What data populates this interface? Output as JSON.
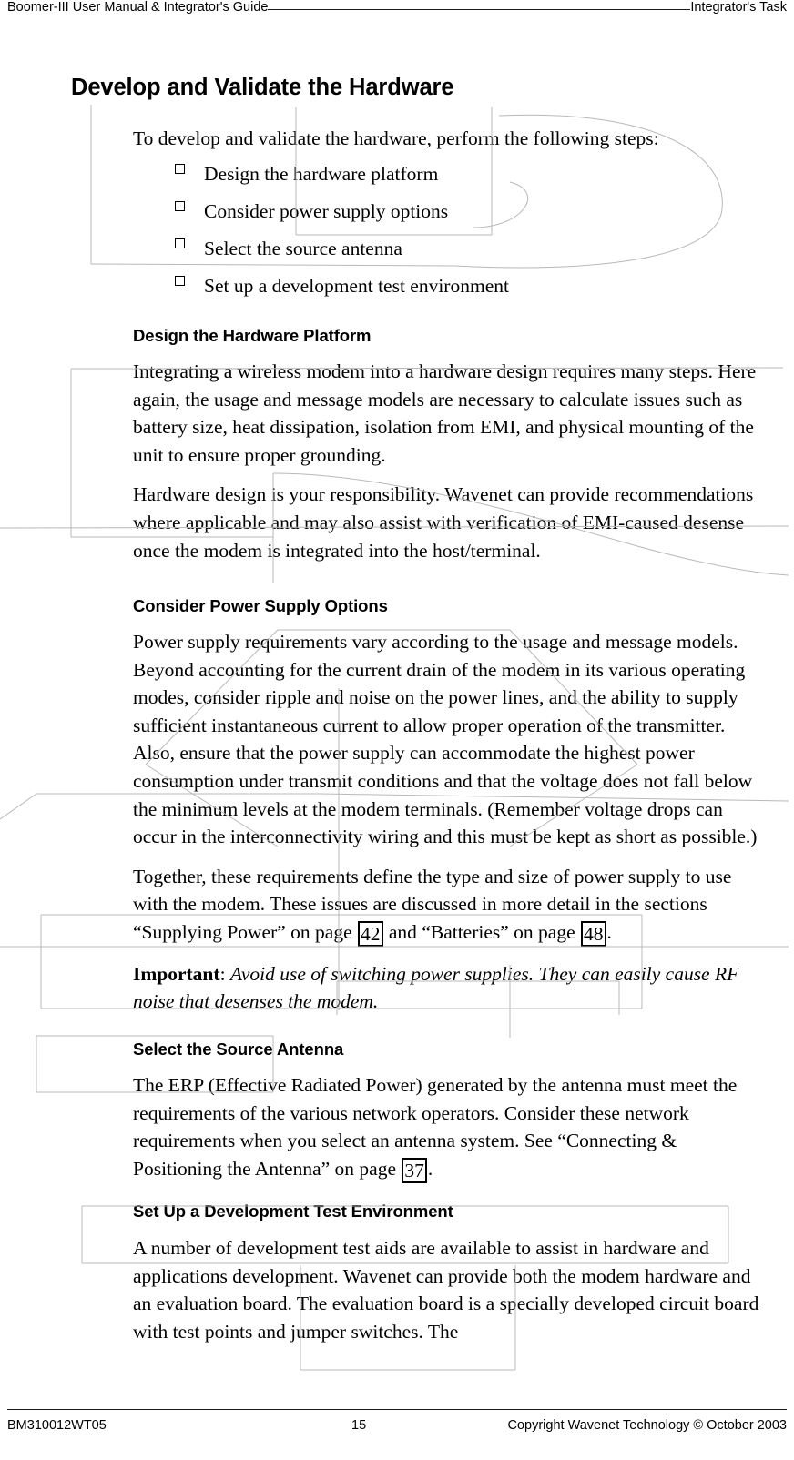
{
  "header": {
    "left_text": "Boomer-III User Manual & Integrator's Guide",
    "rule_text": "______________________________________________",
    "right_text": "Integrator's Task"
  },
  "title": "Develop and Validate the Hardware",
  "intro": "To develop and validate the hardware, perform the following steps:",
  "steps": [
    "Design the hardware platform",
    "Consider power supply options",
    "Select the source antenna",
    "Set up a development test environment"
  ],
  "sections": [
    {
      "heading": "Design the Hardware Platform",
      "paragraphs": [
        "Integrating a wireless modem into a hardware design requires many steps. Here again, the usage and message models are necessary to calculate issues such as battery size, heat dissipation, isolation from EMI, and physical mounting of the unit to ensure proper grounding.",
        "Hardware design is your responsibility. Wavenet can provide recommendations where applicable and may also assist with verification of EMI-caused desense once the modem is integrated into the host/terminal."
      ]
    },
    {
      "heading": "Consider Power Supply Options",
      "paragraphs": [
        "Power supply requirements vary according to the usage and message models. Beyond accounting for the current drain of the modem in its various operating modes, consider ripple and noise on the power lines, and the ability to supply sufficient instantaneous current to allow proper operation of the transmitter. Also, ensure that the power supply can accommodate the highest power consumption under transmit conditions and that the voltage does not fall below the minimum levels at the modem terminals. (Remember voltage drops can occur in the interconnectivity wiring and this must be kept as short as possible.)"
      ],
      "xref_paragraph": {
        "part1": "Together, these requirements define the type and size of power supply to use with the modem. These issues are discussed in more detail in the sections “Supplying Power” on page ",
        "xref1": "42",
        "part2": " and “Batteries” on page ",
        "xref2": "48",
        "part3": "."
      },
      "note": {
        "label": "Important",
        "separator": ": ",
        "text": "Avoid use of switching power supplies. They can easily cause RF noise that desenses the modem."
      }
    },
    {
      "heading": "Select the Source Antenna",
      "xref_paragraph": {
        "part1": "The ERP (Effective Radiated Power) generated by the antenna must meet the requirements of the various network operators. Consider these network requirements when you select an antenna system. See “Connecting & Positioning the Antenna” on page ",
        "xref1": "37",
        "part2": "."
      }
    },
    {
      "heading": "Set Up a Development Test Environment",
      "paragraphs": [
        "A number of development test aids are available to assist in hardware and applications development. Wavenet can provide both the modem hardware and an evaluation board. The evaluation board is a specially developed circuit board with test points and jumper switches. The"
      ]
    }
  ],
  "footer": {
    "doc_number": "BM310012WT05",
    "page_number": "15",
    "copyright": "Copyright Wavenet Technology © October 2003"
  }
}
